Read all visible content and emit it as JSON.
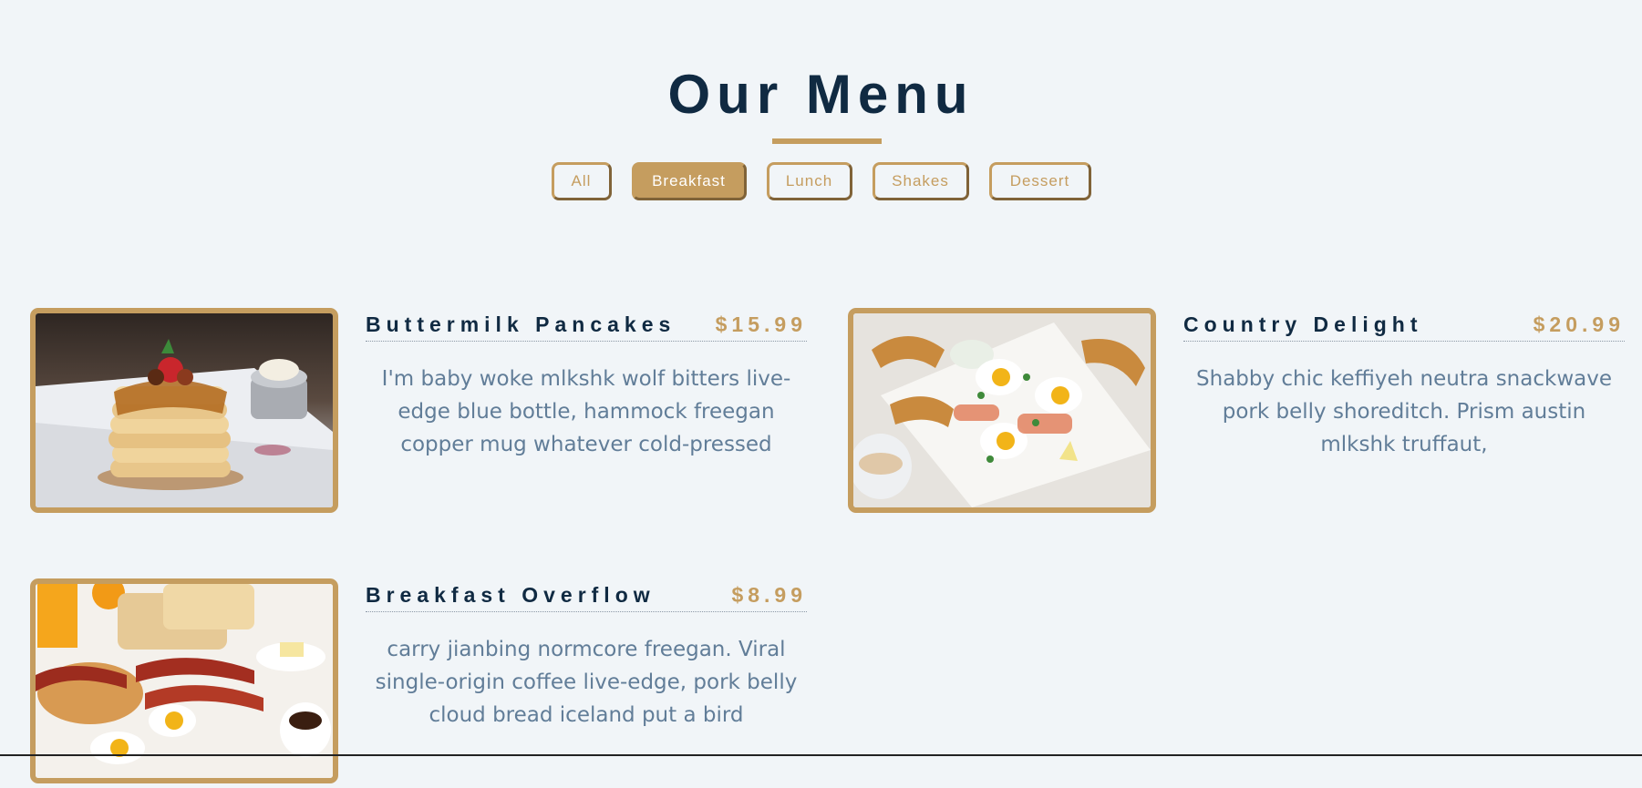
{
  "header": {
    "title": "Our Menu"
  },
  "filters": [
    {
      "label": "All",
      "active": false
    },
    {
      "label": "Breakfast",
      "active": true
    },
    {
      "label": "Lunch",
      "active": false
    },
    {
      "label": "Shakes",
      "active": false
    },
    {
      "label": "Dessert",
      "active": false
    }
  ],
  "items": [
    {
      "name": "Buttermilk Pancakes",
      "price": "$15.99",
      "description": "I'm baby woke mlkshk wolf bitters live-edge blue bottle, hammock freegan copper mug whatever cold-pressed",
      "image_icon": "pancakes-photo"
    },
    {
      "name": "Country Delight",
      "price": "$20.99",
      "description": "Shabby chic keffiyeh neutra snackwave pork belly shoreditch. Prism austin mlkshk truffaut,",
      "image_icon": "croissant-eggs-photo"
    },
    {
      "name": "Breakfast Overflow",
      "price": "$8.99",
      "description": "carry jianbing normcore freegan. Viral single-origin coffee live-edge, pork belly cloud bread iceland put a bird",
      "image_icon": "breakfast-platter-photo"
    }
  ],
  "colors": {
    "background": "#f1f5f8",
    "accent": "#c59d5f",
    "heading": "#102a42",
    "text": "#617d98"
  }
}
